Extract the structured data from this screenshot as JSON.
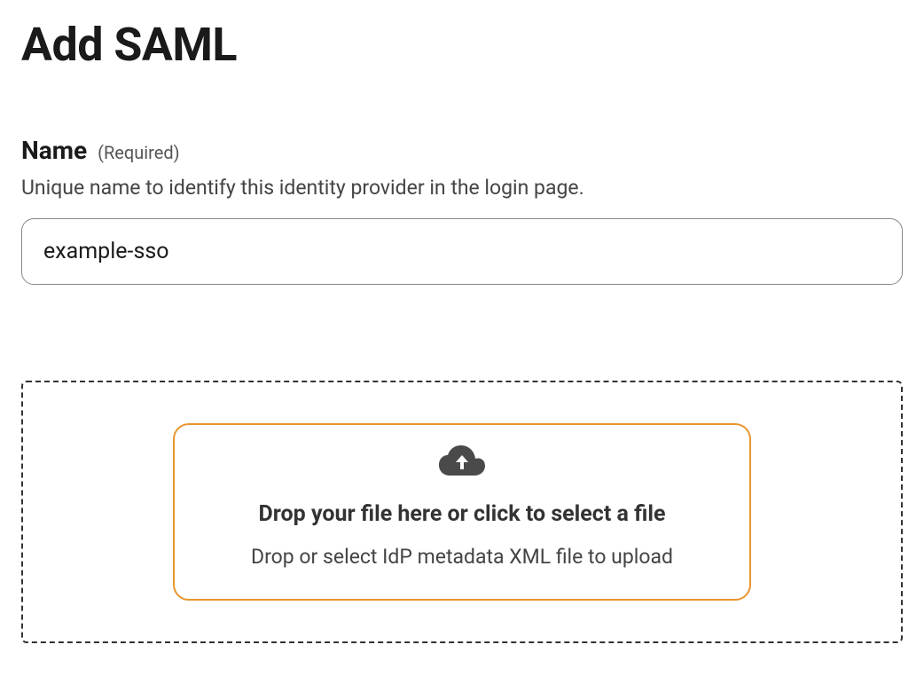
{
  "page": {
    "title": "Add SAML"
  },
  "nameField": {
    "label": "Name",
    "requiredText": "(Required)",
    "helpText": "Unique name to identify this identity provider in the login page.",
    "value": "example-sso"
  },
  "dropzone": {
    "title": "Drop your file here or click to select a file",
    "subtitle": "Drop or select IdP metadata XML file to upload"
  }
}
